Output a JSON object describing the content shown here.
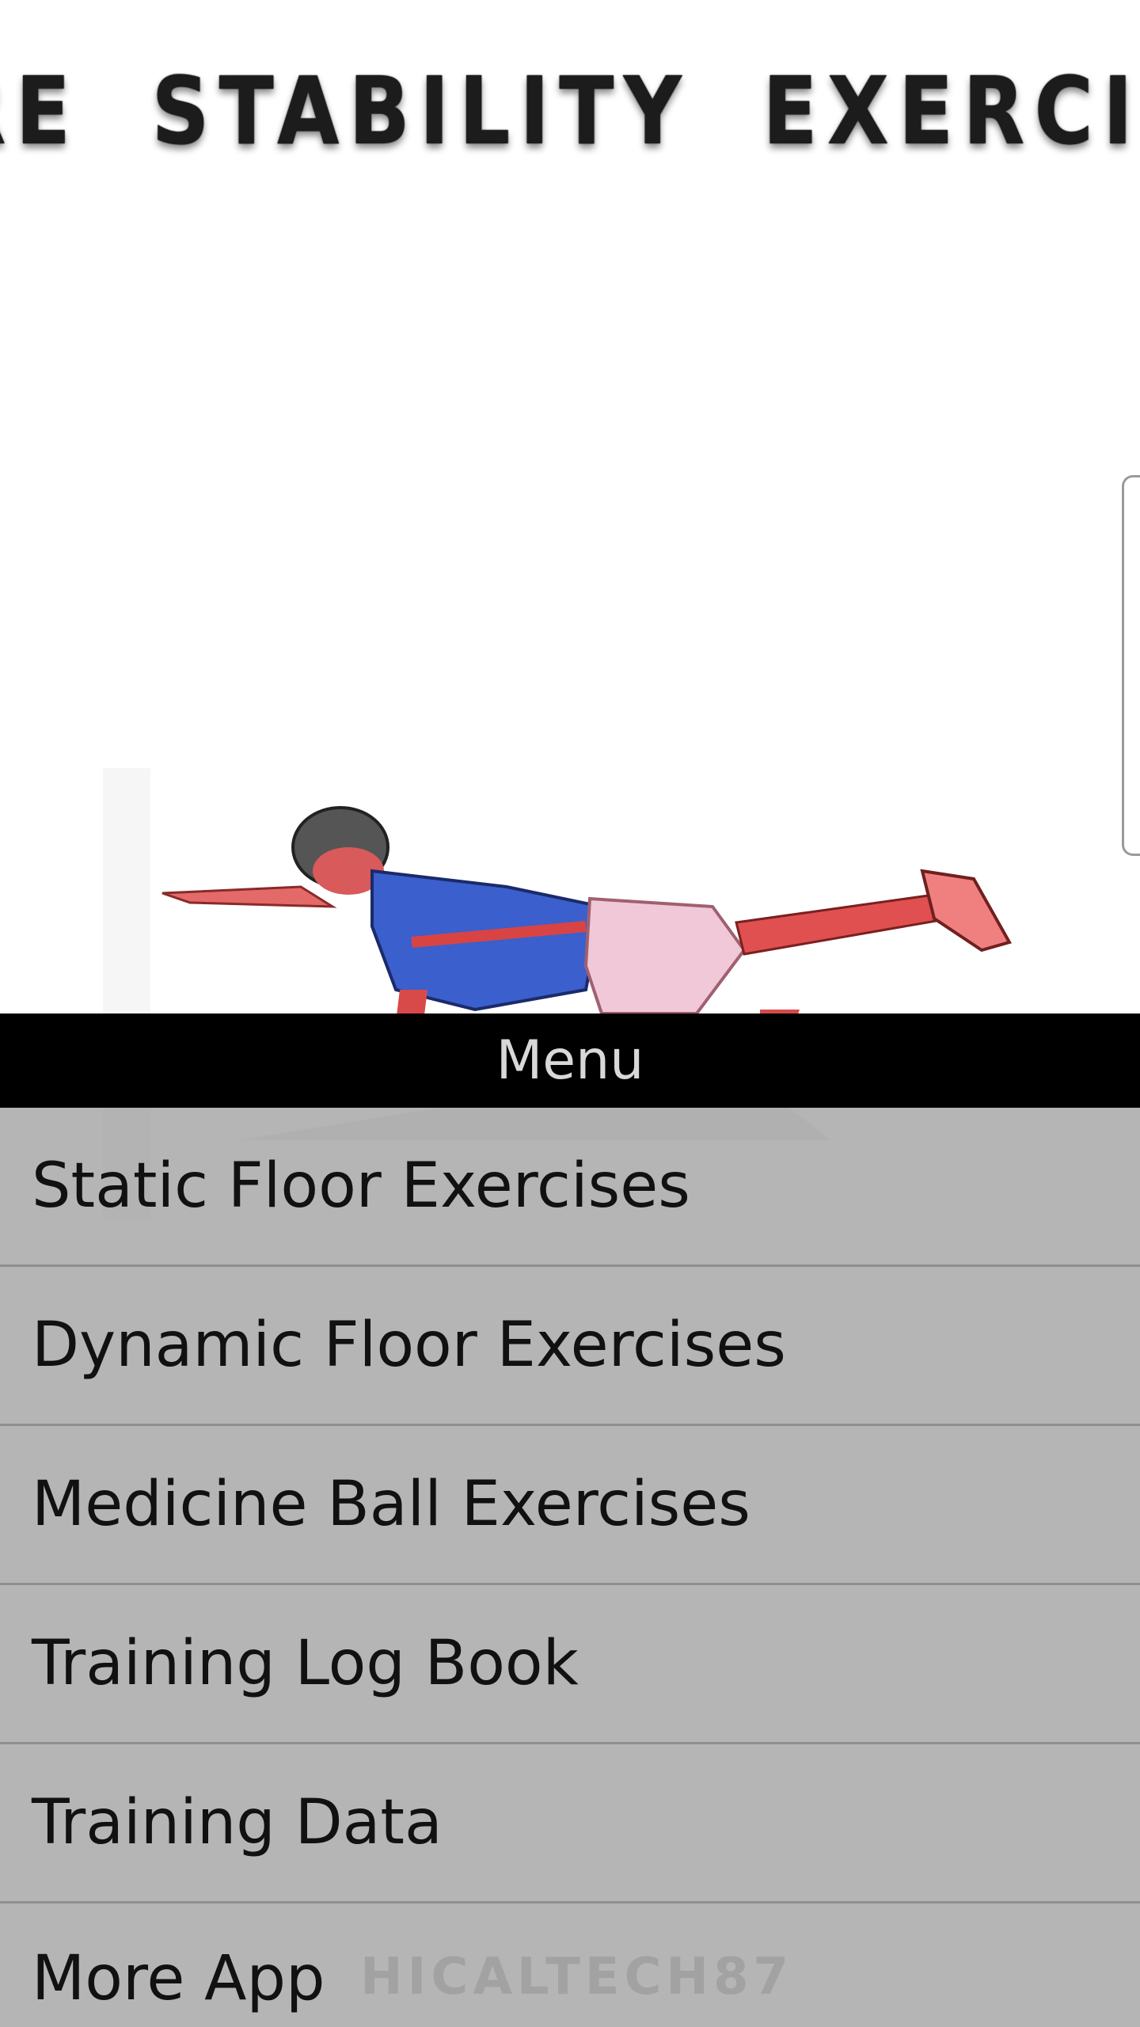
{
  "app": {
    "title": "CORE STABILITY EXERCISES"
  },
  "illustration": {
    "icon": "person-superman-pose-illustration"
  },
  "menu": {
    "header": "Menu",
    "items": [
      {
        "label": "Static Floor Exercises"
      },
      {
        "label": "Dynamic Floor Exercises"
      },
      {
        "label": "Medicine Ball Exercises"
      },
      {
        "label": "Training Log Book"
      },
      {
        "label": "Training Data"
      },
      {
        "label": "More App"
      }
    ]
  },
  "watermark": "HICALTECH87",
  "colors": {
    "menu_header_bg": "#000000",
    "menu_list_bg": "#b8b8b8",
    "title_text": "#1c1c1c"
  }
}
